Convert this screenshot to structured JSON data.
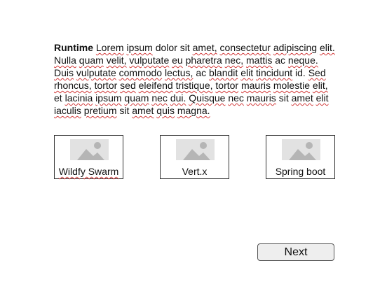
{
  "paragraph": {
    "lead": "Runtime",
    "words": [
      {
        "t": "Lorem",
        "sq": true
      },
      {
        "t": "ipsum",
        "sq": true
      },
      {
        "t": "dolor",
        "sq": false
      },
      {
        "t": "sit",
        "sq": false
      },
      {
        "t": "amet,",
        "sq": true
      },
      {
        "t": "consectetur",
        "sq": true
      },
      {
        "t": "adipiscing",
        "sq": true
      },
      {
        "t": "elit.",
        "sq": true
      },
      {
        "t": "Nulla",
        "sq": true
      },
      {
        "t": "quam",
        "sq": true
      },
      {
        "t": "velit,",
        "sq": true
      },
      {
        "t": "vulputate",
        "sq": true
      },
      {
        "t": "eu",
        "sq": true
      },
      {
        "t": "pharetra",
        "sq": true
      },
      {
        "t": "nec,",
        "sq": true
      },
      {
        "t": "mattis",
        "sq": true
      },
      {
        "t": "ac",
        "sq": false
      },
      {
        "t": "neque.",
        "sq": true
      },
      {
        "t": "Duis",
        "sq": true
      },
      {
        "t": "vulputate",
        "sq": true
      },
      {
        "t": "commodo",
        "sq": true
      },
      {
        "t": "lectus,",
        "sq": true
      },
      {
        "t": "ac",
        "sq": false
      },
      {
        "t": "blandit",
        "sq": true
      },
      {
        "t": "elit",
        "sq": true
      },
      {
        "t": "tincidunt",
        "sq": true
      },
      {
        "t": "id.",
        "sq": false
      },
      {
        "t": "Sed",
        "sq": true
      },
      {
        "t": "rhoncus,",
        "sq": true
      },
      {
        "t": "tortor",
        "sq": true
      },
      {
        "t": "sed",
        "sq": true
      },
      {
        "t": "eleifend",
        "sq": true
      },
      {
        "t": "tristique,",
        "sq": true
      },
      {
        "t": "tortor",
        "sq": true
      },
      {
        "t": "mauris",
        "sq": true
      },
      {
        "t": "molestie",
        "sq": true
      },
      {
        "t": "elit,",
        "sq": true
      },
      {
        "t": "et",
        "sq": false
      },
      {
        "t": "lacinia",
        "sq": true
      },
      {
        "t": "ipsum",
        "sq": true
      },
      {
        "t": "quam",
        "sq": true
      },
      {
        "t": "nec",
        "sq": true
      },
      {
        "t": "dui.",
        "sq": true
      },
      {
        "t": "Quisque",
        "sq": true
      },
      {
        "t": "nec",
        "sq": true
      },
      {
        "t": "mauris",
        "sq": true
      },
      {
        "t": "sit",
        "sq": false
      },
      {
        "t": "amet",
        "sq": true
      },
      {
        "t": "elit",
        "sq": true
      },
      {
        "t": "iaculis",
        "sq": true
      },
      {
        "t": "pretium",
        "sq": true
      },
      {
        "t": "sit",
        "sq": false
      },
      {
        "t": "amet",
        "sq": true
      },
      {
        "t": "quis",
        "sq": true
      },
      {
        "t": "magna.",
        "sq": true
      }
    ]
  },
  "options": [
    {
      "label": "Wildfy Swarm",
      "spellcheck": true,
      "icon": "image-placeholder-icon"
    },
    {
      "label": "Vert.x",
      "spellcheck": false,
      "icon": "image-placeholder-icon"
    },
    {
      "label": "Spring boot",
      "spellcheck": false,
      "icon": "image-placeholder-icon"
    }
  ],
  "next_button": {
    "label": "Next"
  },
  "colors": {
    "spellcheck_underline": "#d23a3a",
    "placeholder_bg": "#e2e2e2",
    "placeholder_shape": "#b5b5b5",
    "button_bg": "#eeeeee"
  }
}
